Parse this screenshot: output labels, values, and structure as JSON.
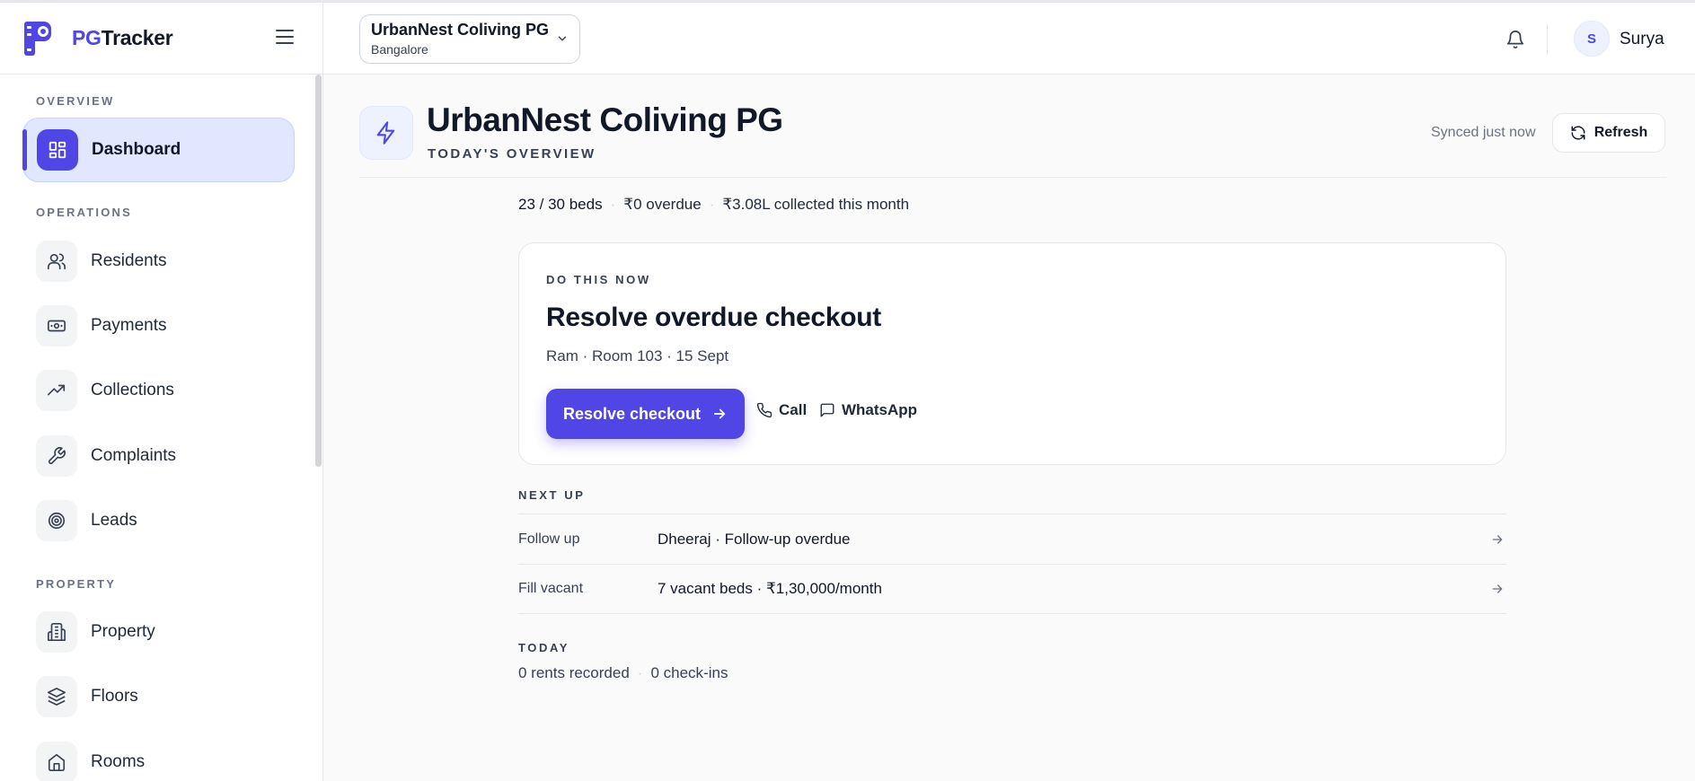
{
  "brand": {
    "prefix": "PG",
    "suffix": "Tracker"
  },
  "sidebar": {
    "sections": [
      {
        "label": "OVERVIEW"
      },
      {
        "label": "OPERATIONS"
      },
      {
        "label": "PROPERTY"
      }
    ],
    "items": [
      {
        "label": "Dashboard",
        "icon": "dashboard-icon",
        "active": true
      },
      {
        "label": "Residents",
        "icon": "users-icon"
      },
      {
        "label": "Payments",
        "icon": "banknote-icon"
      },
      {
        "label": "Collections",
        "icon": "trending-up-icon"
      },
      {
        "label": "Complaints",
        "icon": "wrench-icon"
      },
      {
        "label": "Leads",
        "icon": "target-icon"
      },
      {
        "label": "Property",
        "icon": "building-icon"
      },
      {
        "label": "Floors",
        "icon": "layers-icon"
      },
      {
        "label": "Rooms",
        "icon": "home-icon"
      }
    ]
  },
  "header": {
    "property_name": "UrbanNest Coliving PG",
    "property_city": "Bangalore",
    "user_initial": "S",
    "user_name": "Surya"
  },
  "main": {
    "title": "UrbanNest Coliving PG",
    "subtitle": "TODAY'S OVERVIEW",
    "sync_text": "Synced just now",
    "refresh_label": "Refresh",
    "stats": {
      "beds": "23 / 30 beds",
      "overdue": "₹0 overdue",
      "collected": "₹3.08L collected this month"
    },
    "do_now": {
      "eyebrow": "DO THIS NOW",
      "title": "Resolve overdue checkout",
      "meta": "Ram · Room 103 · 15 Sept",
      "primary_label": "Resolve checkout",
      "call_label": "Call",
      "whatsapp_label": "WhatsApp"
    },
    "next_up": {
      "label": "NEXT UP",
      "rows": [
        {
          "kind": "Follow up",
          "detail": "Dheeraj · Follow-up overdue"
        },
        {
          "kind": "Fill vacant",
          "detail": "7 vacant beds · ₹1,30,000/month"
        }
      ]
    },
    "today": {
      "label": "TODAY",
      "rents": "0 rents recorded",
      "checkins": "0 check-ins"
    }
  },
  "colors": {
    "accent": "#4f46e5",
    "accent_soft": "#e0e7ff"
  }
}
